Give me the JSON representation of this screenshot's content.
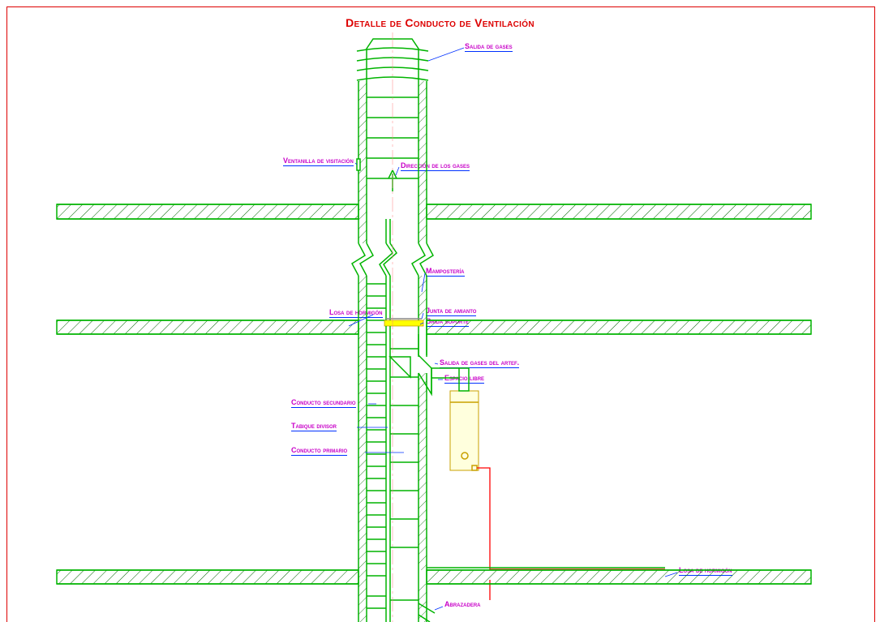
{
  "title": "Detalle de Conducto de Ventilación",
  "labels": {
    "salida_gases": "Salida de gases",
    "ventanilla": "Ventanilla de visitación",
    "direccion_gases": "Dirección de los gases",
    "mamposteria": "Mampostería",
    "losa_hormigon": "Losa de hormigón",
    "junta_amianto": "Junta de amianto",
    "brida_soporte": "Brida soporte",
    "salida_gases_artef": "Salida de gases del artef.",
    "espacio_libre": "Espacio libre",
    "conducto_secundario": "Conducto secundario",
    "tabique_divisor": "Tabique divisor",
    "conducto_primario": "Conducto primario",
    "losa_hormigon2": "Losa de hormigón",
    "abrazadera": "Abrazadera"
  },
  "colors": {
    "outline": "#00b400",
    "label_text": "#c800c8",
    "label_line": "#0030ff",
    "frame": "#d00",
    "hatch": "#006400",
    "flange": "#ffff00",
    "appliance_fill": "#ffffc8",
    "pipe": "#ff0000"
  }
}
